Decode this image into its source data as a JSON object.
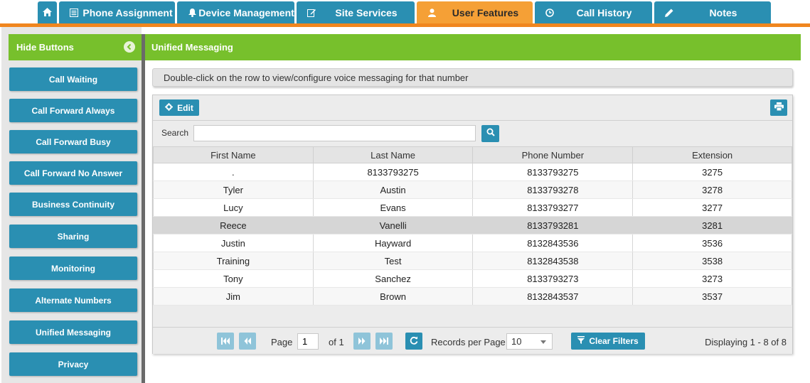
{
  "tabs": [
    {
      "label": "",
      "icon": "home-icon"
    },
    {
      "label": "Phone Assignment",
      "icon": "list-icon"
    },
    {
      "label": "Device Management",
      "icon": "bell-icon"
    },
    {
      "label": "Site Services",
      "icon": "edit-icon"
    },
    {
      "label": "User Features",
      "icon": "user-icon",
      "active": true
    },
    {
      "label": "Call History",
      "icon": "clock-icon"
    },
    {
      "label": "Notes",
      "icon": "pencil-icon"
    }
  ],
  "sidebar": {
    "header": "Hide Buttons",
    "buttons": [
      "Call Waiting",
      "Call Forward Always",
      "Call Forward Busy",
      "Call Forward No Answer",
      "Business Continuity",
      "Sharing",
      "Monitoring",
      "Alternate Numbers",
      "Unified Messaging",
      "Privacy"
    ]
  },
  "main": {
    "title": "Unified Messaging",
    "hint": "Double-click on the row to view/configure voice messaging for that number"
  },
  "grid": {
    "edit_label": "Edit",
    "search_label": "Search",
    "search_value": "",
    "columns": [
      "First Name",
      "Last Name",
      "Phone Number",
      "Extension"
    ],
    "rows": [
      [
        ".",
        "8133793275",
        "8133793275",
        "3275"
      ],
      [
        "Tyler",
        "Austin",
        "8133793278",
        "3278"
      ],
      [
        "Lucy",
        "Evans",
        "8133793277",
        "3277"
      ],
      [
        "Reece",
        "Vanelli",
        "8133793281",
        "3281"
      ],
      [
        "Justin",
        "Hayward",
        "8132843536",
        "3536"
      ],
      [
        "Training",
        "Test",
        "8132843538",
        "3538"
      ],
      [
        "Tony",
        "Sanchez",
        "8133793273",
        "3273"
      ],
      [
        "Jim",
        "Brown",
        "8132843537",
        "3537"
      ]
    ],
    "selected_row": 3
  },
  "pager": {
    "page_label": "Page",
    "page_value": "1",
    "of_label": "of 1",
    "rpp_label": "Records per Page",
    "rpp_value": "10",
    "clear_filters": "Clear Filters",
    "displaying": "Displaying 1 - 8 of 8"
  },
  "colors": {
    "accent_blue": "#2a8fb2",
    "accent_green": "#77c02c",
    "accent_orange": "#f0861e",
    "active_tab": "#f5a036"
  }
}
